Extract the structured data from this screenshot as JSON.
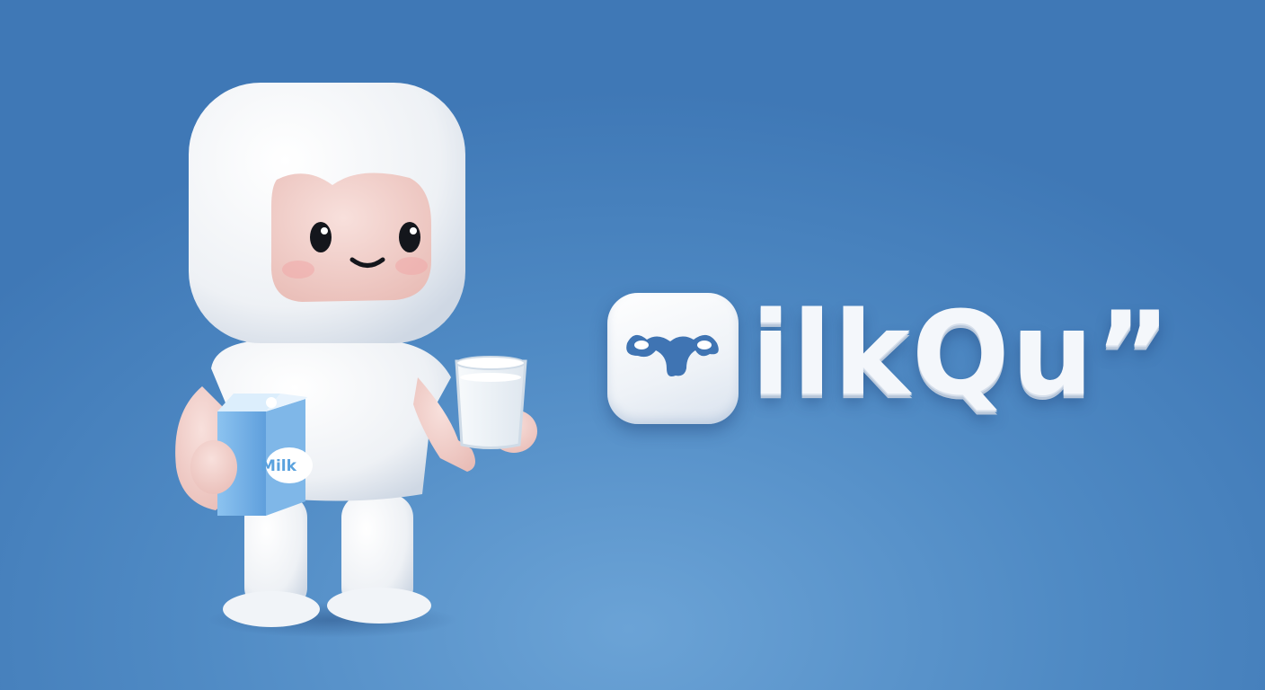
{
  "brand": {
    "wordmark": "ilkQu”",
    "carton_label": "Milk"
  },
  "colors": {
    "background": "#4f8ac4",
    "logo_white": "#f4f7fb",
    "carton_blue": "#6fb0e8",
    "skin": "#f3d3cf"
  },
  "icons": {
    "logo_icon": "milk-splash-icon",
    "milk_carton": "milk-carton-icon",
    "milk_glass": "milk-glass-icon"
  }
}
